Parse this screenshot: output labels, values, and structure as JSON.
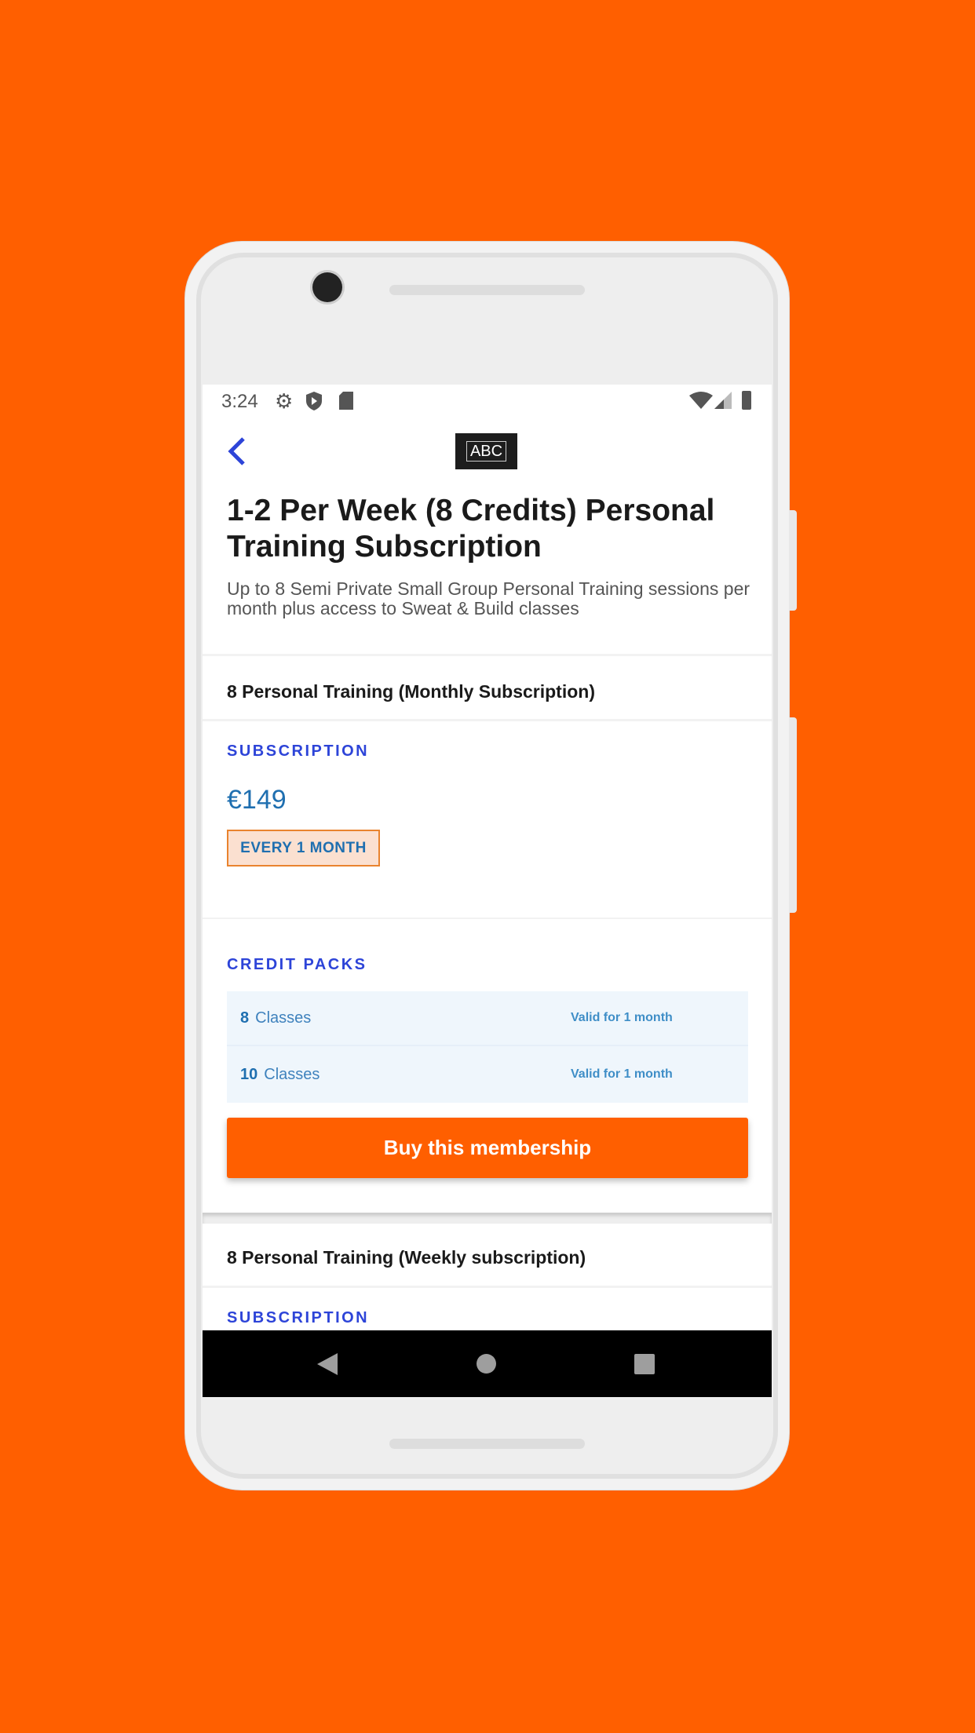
{
  "status_bar": {
    "time": "3:24",
    "icons": [
      "gear-icon",
      "shield-play-icon",
      "sd-card-icon",
      "wifi-icon",
      "signal-icon",
      "battery-icon"
    ]
  },
  "header": {
    "back_icon": "chevron-left-icon",
    "logo_text": "ABC"
  },
  "page": {
    "title": "1-2 Per Week (8 Credits) Personal Training Subscription",
    "description": "Up to 8 Semi Private Small Group Personal Training sessions per month plus access to Sweat & Build classes"
  },
  "plans": [
    {
      "name": "8 Personal Training (Monthly Subscription)",
      "subscription_label": "SUBSCRIPTION",
      "price": "€149",
      "period": "EVERY 1 MONTH",
      "credit_packs_label": "CREDIT PACKS",
      "packs": [
        {
          "count": "8",
          "unit": "Classes",
          "validity": "Valid for 1 month"
        },
        {
          "count": "10",
          "unit": "Classes",
          "validity": "Valid for 1 month"
        }
      ],
      "buy_label": "Buy this membership"
    },
    {
      "name": "8 Personal Training (Weekly subscription)",
      "subscription_label": "SUBSCRIPTION"
    }
  ],
  "colors": {
    "accent": "#FF5F00",
    "label_blue": "#2D44D8",
    "price_blue": "#1F6FB0"
  }
}
